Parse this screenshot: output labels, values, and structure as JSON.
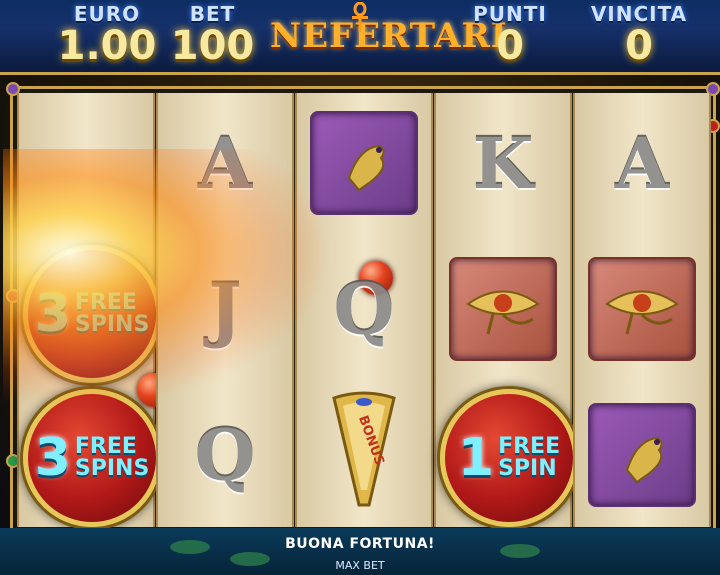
{
  "header": {
    "euro_label": "EURO",
    "euro_value": "1.00",
    "bet_label": "BET",
    "bet_value": "100",
    "logo": "NEFERTARI",
    "punti_label": "PUNTI",
    "punti_value": "0",
    "vincita_label": "VINCITA",
    "vincita_value": "0"
  },
  "reels": {
    "r1": {
      "fs_top_num": "3",
      "fs_top_word1": "FREE",
      "fs_top_word2": "SPINS",
      "fs_bottom_num": "3",
      "fs_bottom_word1": "FREE",
      "fs_bottom_word2": "SPINS"
    },
    "r2": {
      "top": "A",
      "mid": "J",
      "bot": "Q"
    },
    "r3": {
      "top_icon": "falcon-icon",
      "bot_icon": "bonus-shield-icon",
      "bonus_text": "BONUS"
    },
    "r4": {
      "top": "K",
      "mid_icon": "eye-of-horus-icon",
      "fs_num": "1",
      "fs_word1": "FREE",
      "fs_word2": "SPIN"
    },
    "r5": {
      "top": "A",
      "mid_icon": "eye-of-horus-icon",
      "bot_icon": "falcon-icon"
    }
  },
  "footer": {
    "message": "BUONA FORTUNA!",
    "max_bet": "MAX BET"
  },
  "colors": {
    "header_bg": "#0d2e63",
    "gold": "#c9a44a",
    "badge_red": "#b01818",
    "badge_text": "#7ef0ff"
  }
}
